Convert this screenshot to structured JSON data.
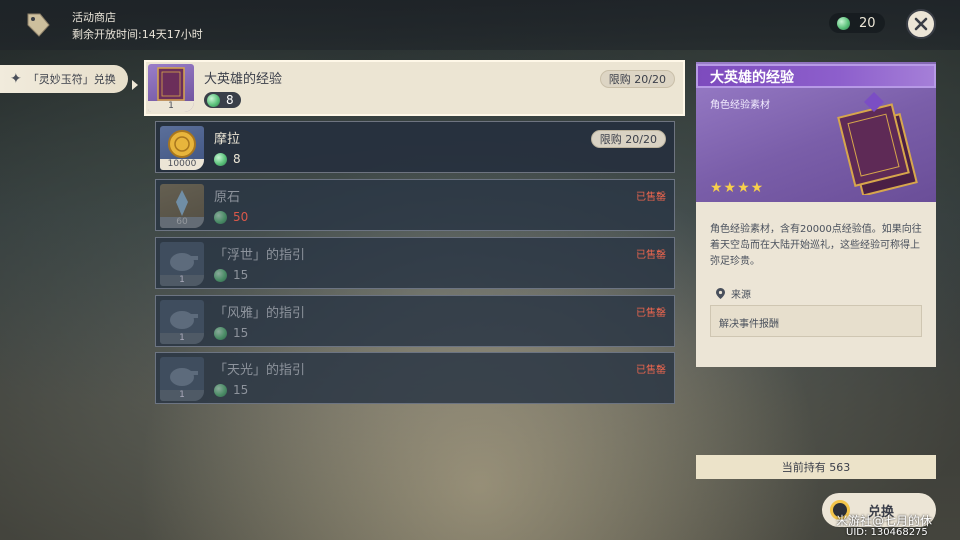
{
  "header": {
    "shop_title": "活动商店",
    "timer": "剩余开放时间:14天17小时",
    "currency_amount": "20"
  },
  "side_tab": {
    "label": "「灵妙玉符」兑换"
  },
  "items": [
    {
      "name": "大英雄的经验",
      "price": "8",
      "qty": "1",
      "limit": "限购 20/20",
      "status": "selected"
    },
    {
      "name": "摩拉",
      "price": "8",
      "qty": "10000",
      "limit": "限购 20/20",
      "status": "normal"
    },
    {
      "name": "原石",
      "price": "50",
      "qty": "60",
      "sold": "已售罄",
      "status": "soldout"
    },
    {
      "name": "「浮世」的指引",
      "price": "15",
      "qty": "1",
      "sold": "已售罄",
      "status": "soldout"
    },
    {
      "name": "「风雅」的指引",
      "price": "15",
      "qty": "1",
      "sold": "已售罄",
      "status": "soldout"
    },
    {
      "name": "「天光」的指引",
      "price": "15",
      "qty": "1",
      "sold": "已售罄",
      "status": "soldout"
    }
  ],
  "detail": {
    "title": "大英雄的经验",
    "type": "角色经验素材",
    "stars": "★★★★",
    "description": "角色经验素材，含有20000点经验值。如果向往着天空岛而在大陆开始巡礼，这些经验可称得上弥足珍贵。",
    "source_label": "来源",
    "source": "解决事件报酬"
  },
  "holding": "当前持有 563",
  "exchange_label": "兑换",
  "watermark": "米游社@七月的休",
  "uid": "UID: 130468275",
  "colors": {
    "accent_purple": "#8d5fcc",
    "sold_red": "#e9654e",
    "star_gold": "#f7cf4b"
  }
}
